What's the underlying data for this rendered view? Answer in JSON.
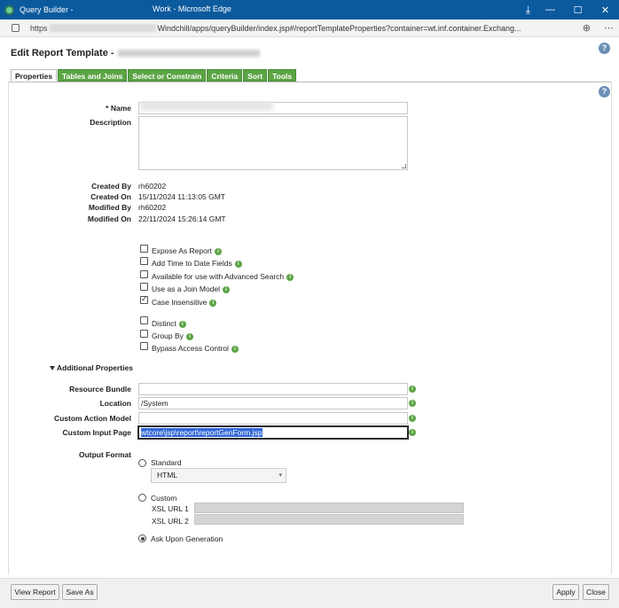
{
  "window": {
    "tab_title": "Query Builder -",
    "title": "Work - Microsoft Edge",
    "url_prefix": "https",
    "url": "Windchill/apps/queryBuilder/index.jsp#/reportTemplateProperties?container=wt.inf.container.Exchang..."
  },
  "page": {
    "title": "Edit Report Template",
    "help": "?"
  },
  "tabs": [
    "Properties",
    "Tables and Joins",
    "Select or Constrain",
    "Criteria",
    "Sort",
    "Tools"
  ],
  "form": {
    "name_label": "* Name",
    "description_label": "Description",
    "created_by_label": "Created By",
    "created_by": "rh60202",
    "created_on_label": "Created On",
    "created_on": "15/11/2024 11:13:05 GMT",
    "modified_by_label": "Modified By",
    "modified_by": "rh60202",
    "modified_on_label": "Modified On",
    "modified_on": "22/11/2024 15:26:14 GMT"
  },
  "options": [
    {
      "label": "Expose As Report",
      "checked": false
    },
    {
      "label": "Add Time to Date Fields",
      "checked": false
    },
    {
      "label": "Available for use with Advanced Search",
      "checked": false
    },
    {
      "label": "Use as a Join Model",
      "checked": false
    },
    {
      "label": "Case Insensitive",
      "checked": true
    },
    {
      "label": "Distinct",
      "checked": false
    },
    {
      "label": "Group By",
      "checked": false
    },
    {
      "label": "Bypass Access Control",
      "checked": false
    }
  ],
  "additional": {
    "section_title": "Additional Properties",
    "resource_bundle_label": "Resource Bundle",
    "resource_bundle": "",
    "location_label": "Location",
    "location": "/System",
    "custom_action_model_label": "Custom Action Model",
    "custom_action_model": "",
    "custom_input_page_label": "Custom Input Page",
    "custom_input_page": "wtcore\\jsp\\report\\reportGenForm.jsp"
  },
  "output": {
    "label": "Output Format",
    "standard_label": "Standard",
    "standard_select": "HTML",
    "custom_label": "Custom",
    "xsl1_label": "XSL URL 1",
    "xsl2_label": "XSL URL 2",
    "ask_label": "Ask Upon Generation",
    "selected": "ask"
  },
  "footer": {
    "view_report": "View Report",
    "save_as": "Save As",
    "apply": "Apply",
    "close": "Close"
  },
  "icons": {
    "info": "i",
    "arrow": "▾"
  }
}
